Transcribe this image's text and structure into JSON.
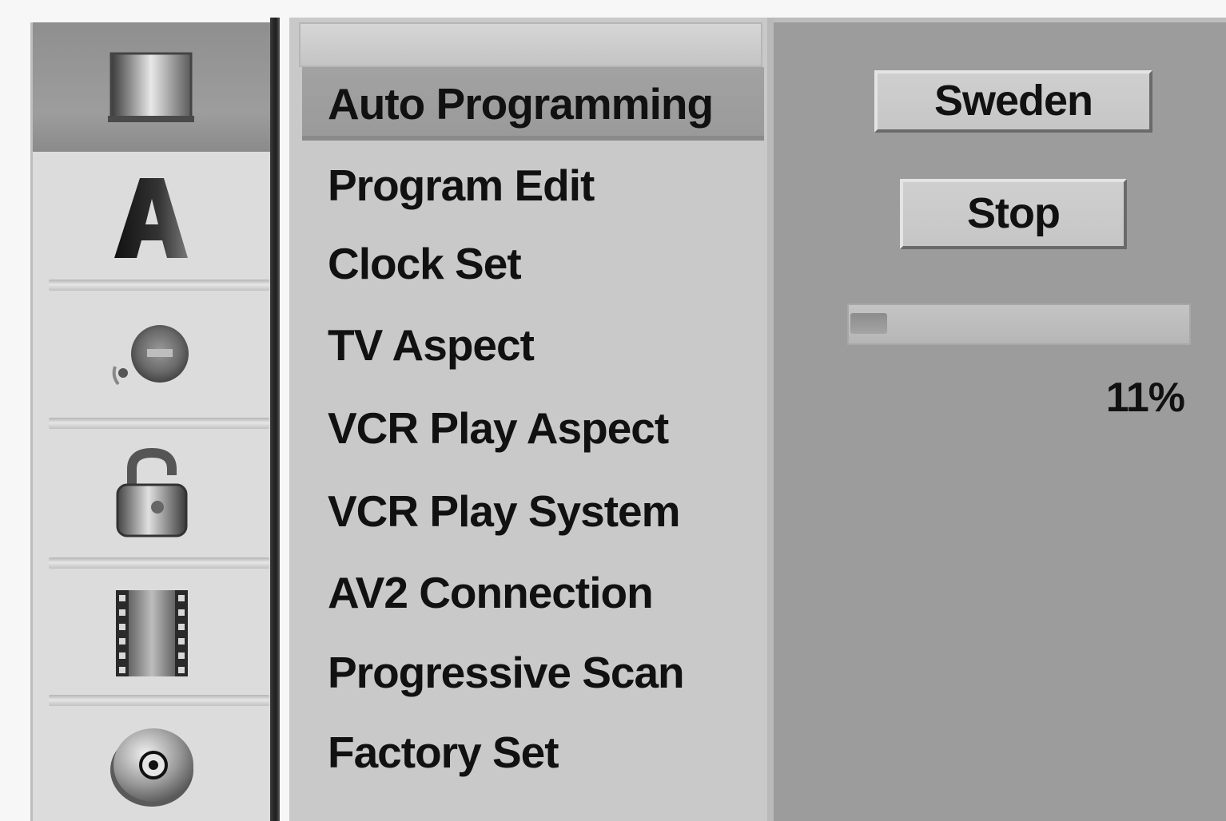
{
  "sidebar": {
    "items": [
      {
        "icon": "tv-screen-icon",
        "active": true
      },
      {
        "icon": "letter-a-icon",
        "active": false
      },
      {
        "icon": "audio-speaker-icon",
        "active": false
      },
      {
        "icon": "padlock-icon",
        "active": false
      },
      {
        "icon": "film-strip-icon",
        "active": false
      },
      {
        "icon": "disc-icon",
        "active": false
      }
    ]
  },
  "menu": {
    "items": [
      {
        "label": "Auto Programming",
        "selected": true
      },
      {
        "label": "Program Edit",
        "selected": false
      },
      {
        "label": "Clock Set",
        "selected": false
      },
      {
        "label": "TV Aspect",
        "selected": false
      },
      {
        "label": "VCR Play Aspect",
        "selected": false
      },
      {
        "label": "VCR Play System",
        "selected": false
      },
      {
        "label": "AV2 Connection",
        "selected": false
      },
      {
        "label": "Progressive Scan",
        "selected": false
      },
      {
        "label": "Factory Set",
        "selected": false
      }
    ]
  },
  "panel": {
    "country_value": "Sweden",
    "stop_label": "Stop",
    "progress_percent": 11,
    "progress_text": "11%"
  },
  "colors": {
    "panel_bg": "#9c9c9c",
    "menu_bg": "#c9c9c9",
    "selected_bg": "#9e9e9e",
    "text": "#111111"
  }
}
